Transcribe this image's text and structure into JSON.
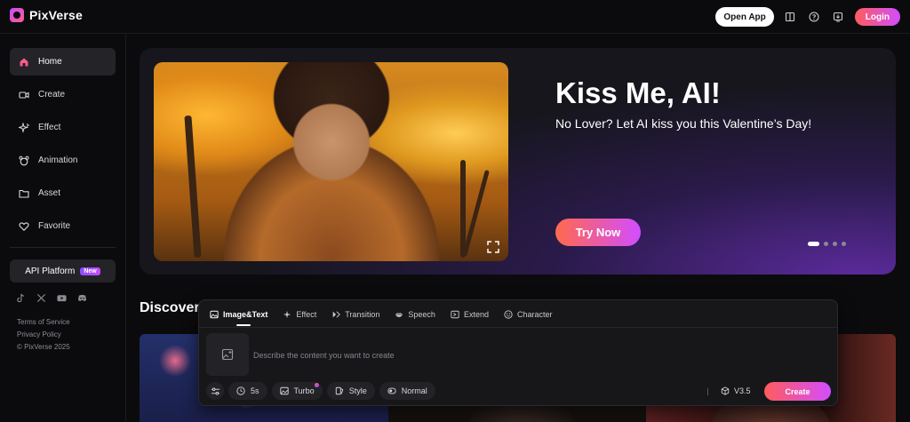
{
  "brand": {
    "name": "PixVerse"
  },
  "header": {
    "open_app": "Open App",
    "login": "Login"
  },
  "sidebar": {
    "items": [
      {
        "label": "Home",
        "icon": "home-icon",
        "active": true
      },
      {
        "label": "Create",
        "icon": "video-icon"
      },
      {
        "label": "Effect",
        "icon": "sparkle-icon"
      },
      {
        "label": "Animation",
        "icon": "bear-icon"
      },
      {
        "label": "Asset",
        "icon": "folder-icon"
      },
      {
        "label": "Favorite",
        "icon": "heart-icon"
      }
    ],
    "api_platform": "API Platform",
    "new_badge": "New",
    "socials": [
      "tiktok-icon",
      "x-icon",
      "youtube-icon",
      "discord-icon"
    ],
    "terms": "Terms of Service",
    "privacy": "Privacy Policy",
    "copyright": "© PixVerse 2025"
  },
  "hero": {
    "title": "Kiss Me, AI!",
    "subtitle": "No Lover? Let AI kiss you this Valentine’s Day!",
    "cta": "Try Now",
    "slides": 4,
    "active_slide": 1
  },
  "discover": {
    "title": "Discover"
  },
  "panel": {
    "tabs": [
      {
        "label": "Image&Text",
        "icon": "image-icon",
        "active": true
      },
      {
        "label": "Effect",
        "icon": "sparkle-icon"
      },
      {
        "label": "Transition",
        "icon": "transition-icon"
      },
      {
        "label": "Speech",
        "icon": "lips-icon"
      },
      {
        "label": "Extend",
        "icon": "extend-icon"
      },
      {
        "label": "Character",
        "icon": "character-icon"
      }
    ],
    "prompt_placeholder": "Describe the content you want to create",
    "options": {
      "duration": "5s",
      "turbo": "Turbo",
      "style": "Style",
      "mode": "Normal"
    },
    "model": "V3.5",
    "create": "Create"
  },
  "colors": {
    "accent_start": "#ff5c5c",
    "accent_end": "#d24dff",
    "background": "#0b0b0d"
  }
}
